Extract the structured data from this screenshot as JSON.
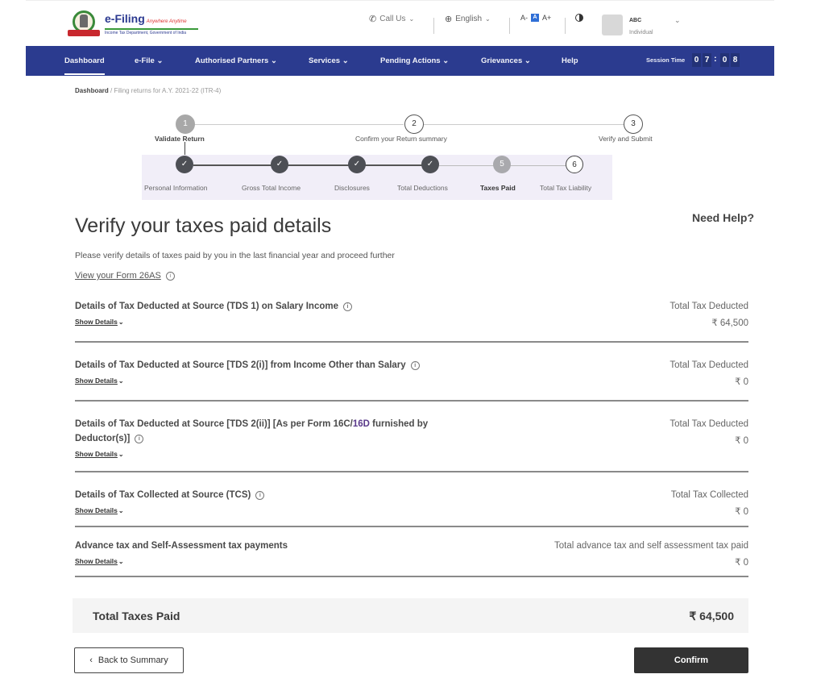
{
  "header": {
    "logo_title": "e-Filing",
    "logo_tagline": "Anywhere Anytime",
    "logo_subtitle": "Income Tax Department, Government of India",
    "call_us": "Call Us",
    "language": "English",
    "font_decrease": "A-",
    "font_normal": "A",
    "font_increase": "A+",
    "user_name": "ABC",
    "user_role": "Individual"
  },
  "nav": {
    "items": [
      {
        "label": "Dashboard",
        "dropdown": false,
        "active": true
      },
      {
        "label": "e-File",
        "dropdown": true
      },
      {
        "label": "Authorised Partners",
        "dropdown": true
      },
      {
        "label": "Services",
        "dropdown": true
      },
      {
        "label": "Pending Actions",
        "dropdown": true
      },
      {
        "label": "Grievances",
        "dropdown": true
      },
      {
        "label": "Help",
        "dropdown": false
      }
    ],
    "session_label": "Session Time",
    "session_digits": [
      "0",
      "7",
      "0",
      "8"
    ]
  },
  "breadcrumb": {
    "root": "Dashboard",
    "current": "Filing returns for A.Y. 2021-22 (ITR-4)"
  },
  "main_steps": [
    {
      "number": "1",
      "label": "Validate Return",
      "state": "done"
    },
    {
      "number": "2",
      "label": "Confirm your Return summary",
      "state": "todo"
    },
    {
      "number": "3",
      "label": "Verify and Submit",
      "state": "todo"
    }
  ],
  "sub_steps": [
    {
      "number": "✓",
      "label": "Personal Information",
      "state": "done"
    },
    {
      "number": "✓",
      "label": "Gross Total Income",
      "state": "done"
    },
    {
      "number": "✓",
      "label": "Disclosures",
      "state": "done"
    },
    {
      "number": "✓",
      "label": "Total Deductions",
      "state": "done"
    },
    {
      "number": "5",
      "label": "Taxes Paid",
      "state": "current"
    },
    {
      "number": "6",
      "label": "Total Tax Liability",
      "state": "todo"
    }
  ],
  "content": {
    "title": "Verify your taxes paid details",
    "need_help": "Need Help?",
    "description": "Please verify details of taxes paid by you in the last financial year and proceed further",
    "form_link": "View your Form 26AS",
    "show_details": "Show Details",
    "sections": [
      {
        "title": "Details of Tax Deducted at Source (TDS 1) on Salary Income",
        "info": true,
        "right_label": "Total Tax Deducted",
        "value": "₹ 64,500"
      },
      {
        "title": "Details of Tax Deducted at Source [TDS 2(i)] from Income Other than Salary",
        "info": true,
        "right_label": "Total Tax Deducted",
        "value": "₹ 0"
      },
      {
        "title_part1": "Details of Tax Deducted at Source [TDS 2(ii)] [As per Form 16C/",
        "title_highlight": "16D",
        "title_part2": " furnished by Deductor(s)]",
        "info": true,
        "right_label": "Total Tax Deducted",
        "value": "₹ 0"
      },
      {
        "title": "Details of Tax Collected at Source (TCS)",
        "info": true,
        "right_label": "Total Tax Collected",
        "value": "₹ 0"
      },
      {
        "title": "Advance tax and Self-Assessment tax payments",
        "info": false,
        "right_label": "Total advance tax and self assessment tax paid",
        "value": "₹ 0"
      }
    ],
    "total_label": "Total Taxes Paid",
    "total_value": "₹ 64,500"
  },
  "actions": {
    "back_label": "Back to Summary",
    "confirm_label": "Confirm"
  },
  "colors": {
    "nav_bg": "#2b3b8f",
    "primary_button": "#333333",
    "highlight_text": "#5a3a8a"
  }
}
